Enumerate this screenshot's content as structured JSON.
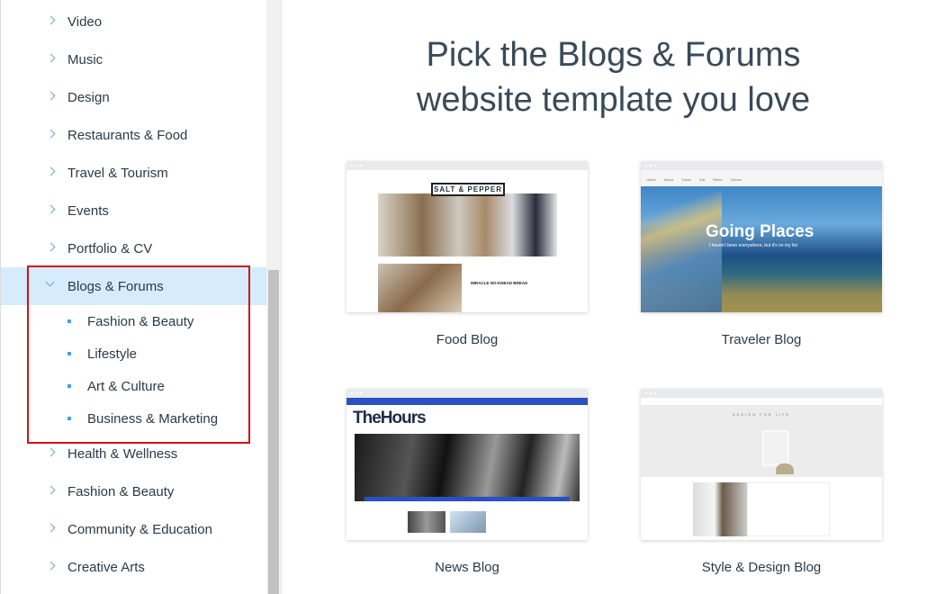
{
  "sidebar": {
    "categories_top": [
      "Video",
      "Music",
      "Design",
      "Restaurants & Food",
      "Travel & Tourism",
      "Events",
      "Portfolio & CV"
    ],
    "expanded": {
      "label": "Blogs & Forums",
      "subcategories": [
        "Fashion & Beauty",
        "Lifestyle",
        "Art & Culture",
        "Business & Marketing"
      ]
    },
    "categories_bottom": [
      "Health & Wellness",
      "Fashion & Beauty",
      "Community & Education",
      "Creative Arts"
    ]
  },
  "main": {
    "title_line1": "Pick the Blogs & Forums",
    "title_line2": "website template you love",
    "templates": [
      {
        "name": "Food Blog",
        "preview_logo": "SALT & PEPPER",
        "preview_post": "MIRACLE NO-KNEAD BREAD"
      },
      {
        "name": "Traveler Blog",
        "preview_heading": "Going Places",
        "preview_sub": "I haven't been everywhere, but it's on my list",
        "preview_nav": [
          "Home",
          "About",
          "Travel",
          "Eat",
          "Relax",
          "Videos"
        ]
      },
      {
        "name": "News Blog",
        "preview_logo": "TheHours"
      },
      {
        "name": "Style & Design Blog",
        "preview_heading": "DESIGN FOR LIFE"
      }
    ]
  },
  "colors": {
    "highlight_box": "#d1121b",
    "selected_bg": "#d6ebfb",
    "accent": "#4aa0dc",
    "news_blue": "#2b4fc4"
  }
}
